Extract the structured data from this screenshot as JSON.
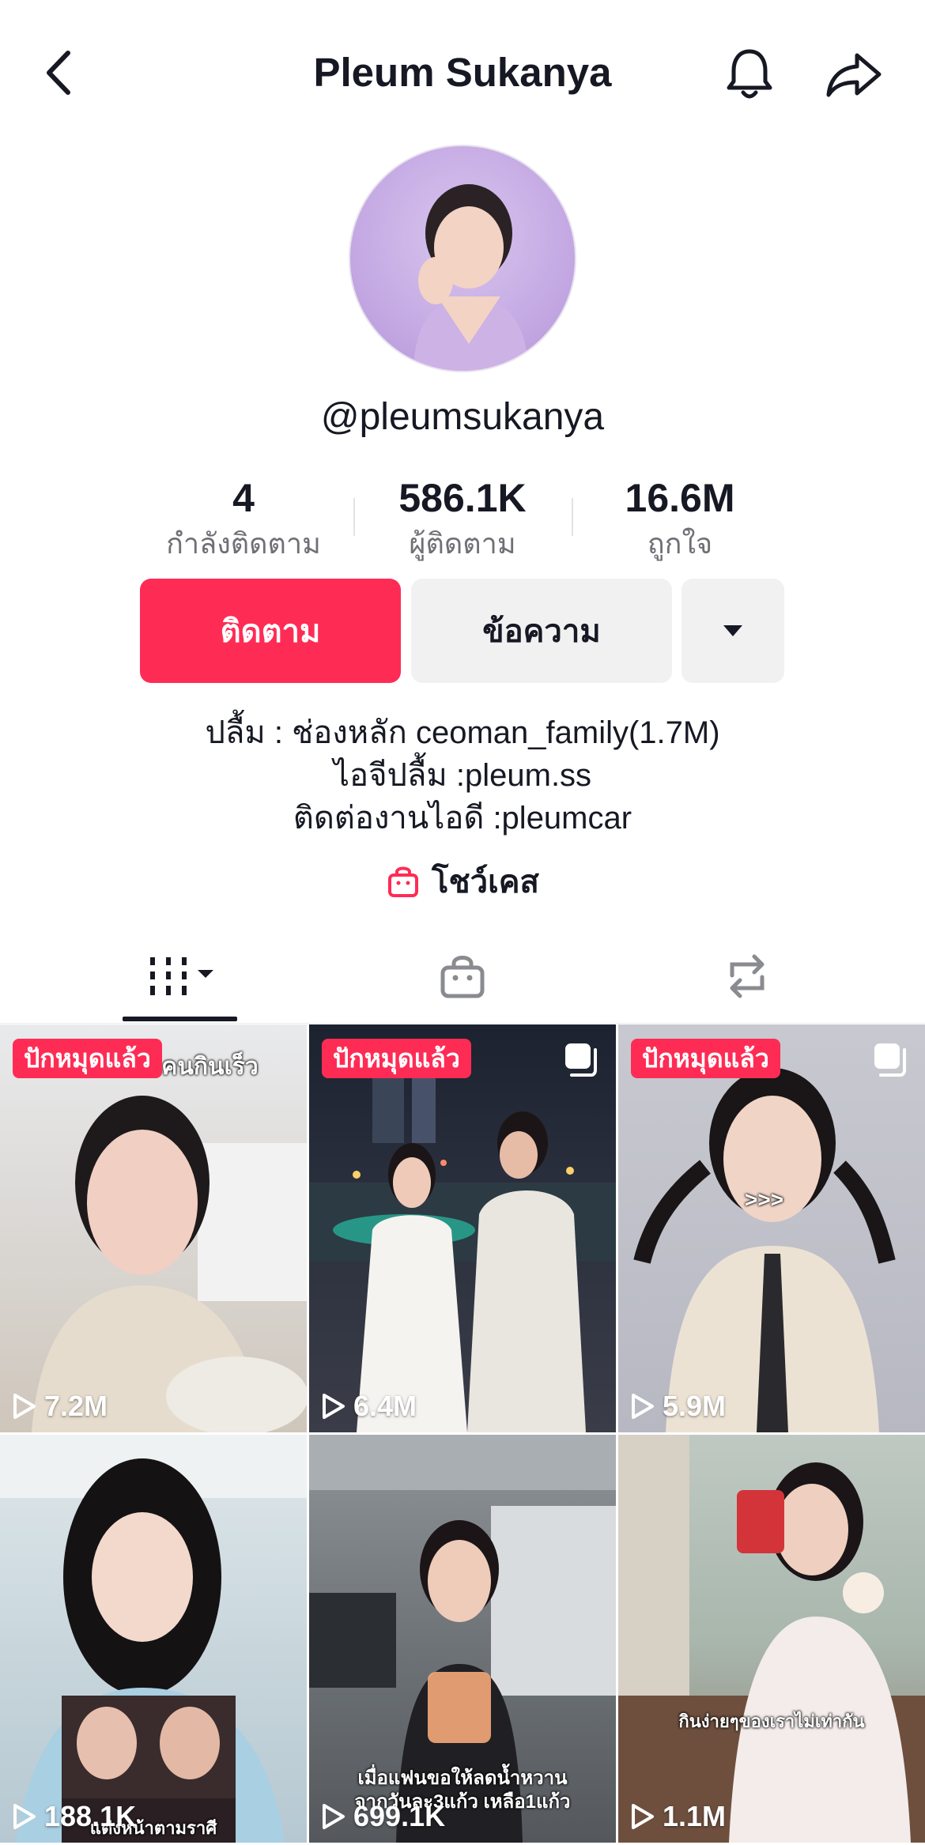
{
  "header": {
    "title": "Pleum Sukanya"
  },
  "profile": {
    "username": "@pleumsukanya"
  },
  "stats": [
    {
      "value": "4",
      "label": "กำลังติดตาม"
    },
    {
      "value": "586.1K",
      "label": "ผู้ติดตาม"
    },
    {
      "value": "16.6M",
      "label": "ถูกใจ"
    }
  ],
  "actions": {
    "follow_label": "ติดตาม",
    "message_label": "ข้อความ"
  },
  "bio": {
    "line1": "ปลื้ม : ช่องหลัก ceoman_family(1.7M)",
    "line2": "ไอจีปลื้ม :pleum.ss",
    "line3": "ติดต่องานไอดี :pleumcar"
  },
  "showcase": {
    "label": "โชว์เคส",
    "icon": "shopping-bag-icon",
    "color": "#fe2c55"
  },
  "tabs": [
    {
      "icon": "videos-grid-icon",
      "active": true
    },
    {
      "icon": "shop-bag-icon",
      "active": false
    },
    {
      "icon": "repost-icon",
      "active": false
    }
  ],
  "videos": [
    {
      "views": "7.2M",
      "pinned": true,
      "pinned_label": "ปักหมุดแล้ว",
      "caption": "เผลอใจเธอคนกินเร็ว",
      "multi": false
    },
    {
      "views": "6.4M",
      "pinned": true,
      "pinned_label": "ปักหมุดแล้ว",
      "caption": "",
      "multi": true
    },
    {
      "views": "5.9M",
      "pinned": true,
      "pinned_label": "ปักหมุดแล้ว",
      "caption": ">>>",
      "multi": true
    },
    {
      "views": "188.1K",
      "pinned": false,
      "caption": "แต่งหน้าตามราศี",
      "multi": false
    },
    {
      "views": "699.1K",
      "pinned": false,
      "caption": "เมื่อแฟนขอให้ลดน้ำหวาน จากวันละ3แก้ว เหลือ1แก้ว",
      "multi": false
    },
    {
      "views": "1.1M",
      "pinned": false,
      "caption": "กินง่ายๆของเราไม่เท่ากัน",
      "multi": false
    }
  ],
  "colors": {
    "accent": "#fe2c55",
    "text": "#161823",
    "muted": "#6f6f75",
    "button_bg": "#f1f1f2"
  }
}
